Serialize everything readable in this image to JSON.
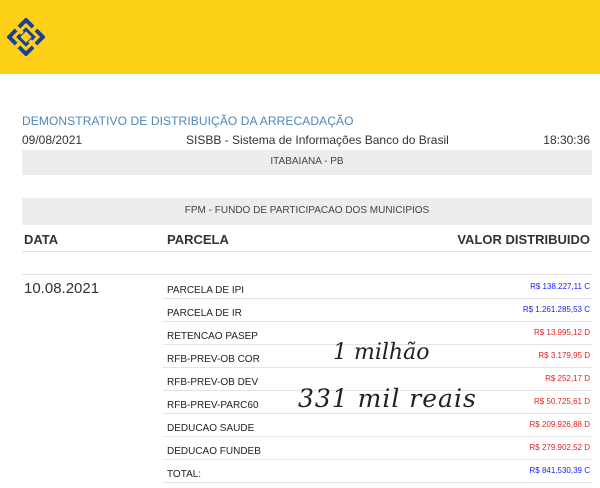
{
  "header": {
    "title": "DEMONSTRATIVO DE DISTRIBUIÇÃO DA ARRECADAÇÃO",
    "date": "09/08/2021",
    "system": "SISBB - Sistema de Informações Banco do Brasil",
    "time": "18:30:36",
    "brand_color": "#fcd116",
    "logo_icon": "banco-do-brasil-logo-icon"
  },
  "city": "ITABAIANA - PB",
  "fund": "FPM - FUNDO DE PARTICIPACAO DOS MUNICIPIOS",
  "columns": {
    "date": "DATA",
    "parcela": "PARCELA",
    "valor": "VALOR DISTRIBUIDO"
  },
  "rows": [
    {
      "date": "10.08.2021",
      "parcela": "PARCELA DE IPI",
      "valor": "R$ 138.227,11 C",
      "type": "C"
    },
    {
      "date": "",
      "parcela": "PARCELA DE IR",
      "valor": "R$ 1.261.285,53 C",
      "type": "C"
    },
    {
      "date": "",
      "parcela": "RETENCAO PASEP",
      "valor": "R$ 13.995,12 D",
      "type": "D"
    },
    {
      "date": "",
      "parcela": "RFB-PREV-OB COR",
      "valor": "R$ 3.179,95 D",
      "type": "D"
    },
    {
      "date": "",
      "parcela": "RFB-PREV-OB DEV",
      "valor": "R$ 252,17 D",
      "type": "D"
    },
    {
      "date": "",
      "parcela": "RFB-PREV-PARC60",
      "valor": "R$ 50.725,61 D",
      "type": "D"
    },
    {
      "date": "",
      "parcela": "DEDUCAO SAUDE",
      "valor": "R$ 209.926,88 D",
      "type": "D"
    },
    {
      "date": "",
      "parcela": "DEDUCAO FUNDEB",
      "valor": "R$ 279.902,52 D",
      "type": "D"
    },
    {
      "date": "",
      "parcela": "TOTAL:",
      "valor": "R$ 841.530,39 C",
      "type": "C"
    }
  ],
  "colors": {
    "credit": "#1a1aff",
    "debit": "#e32222",
    "title": "#4f86b8"
  },
  "annotation": {
    "line1": "1 milhão",
    "line2": "331 mil reais"
  }
}
